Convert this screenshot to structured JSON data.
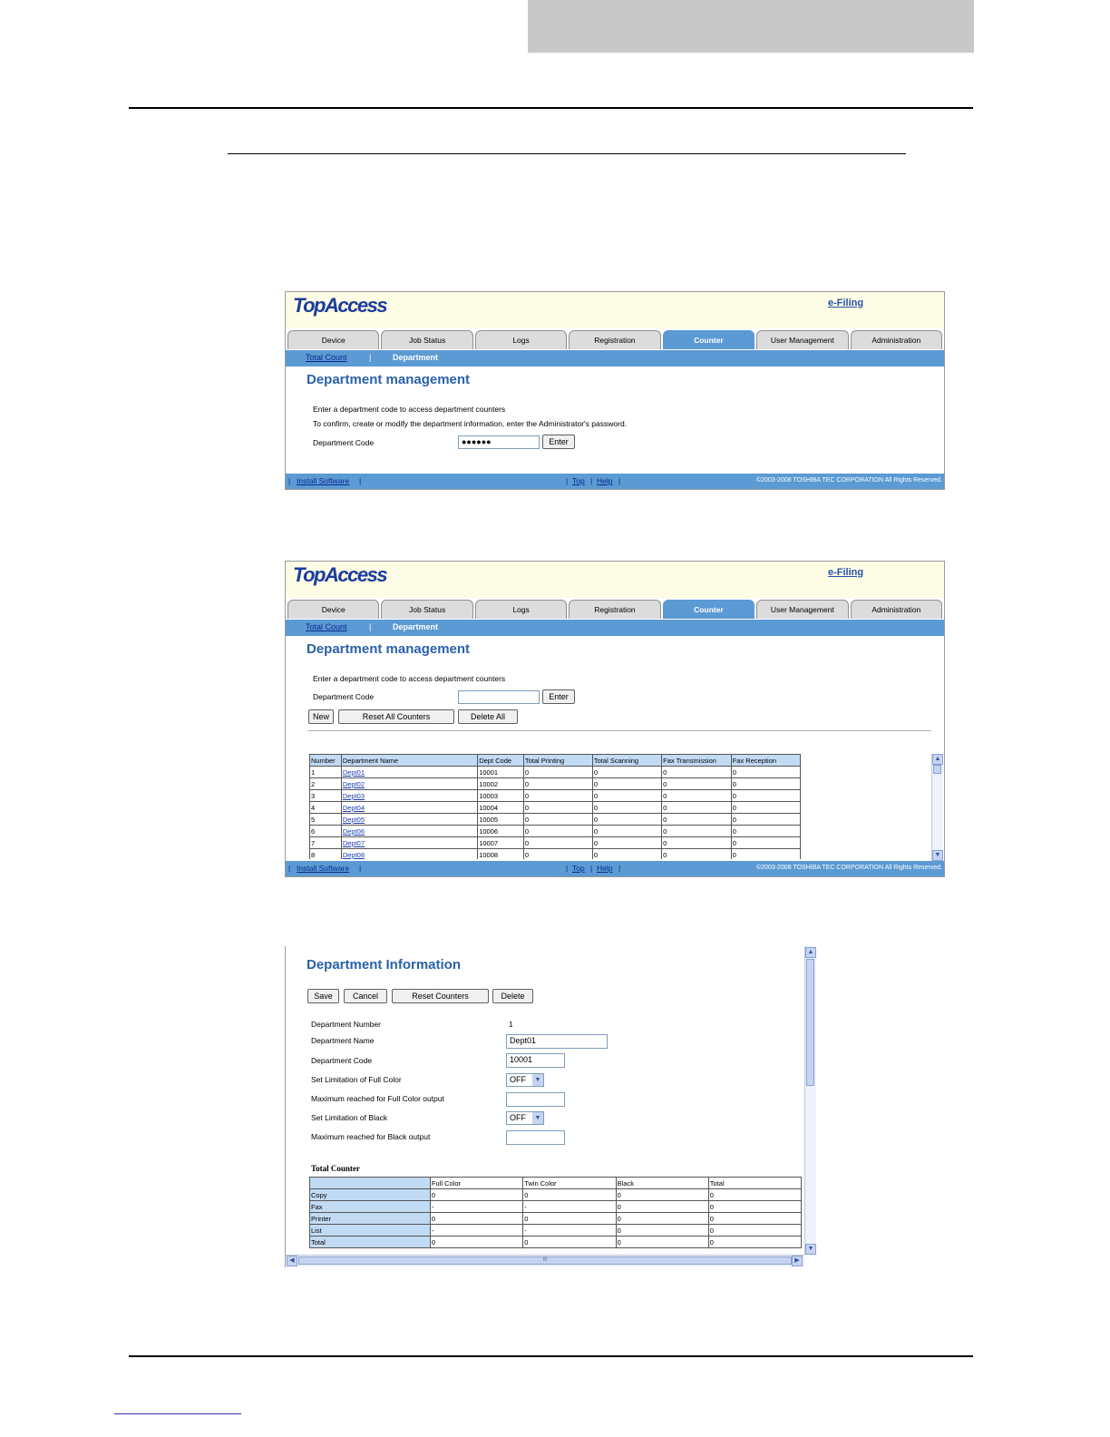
{
  "screen1": {
    "logo": "TopAccess",
    "efiling": "e-Filing",
    "tabs": [
      "Device",
      "Job Status",
      "Logs",
      "Registration",
      "Counter",
      "User Management",
      "Administration"
    ],
    "active_tab": "Counter",
    "subnav": {
      "link": "Total Count",
      "separator": "|",
      "current": "Department"
    },
    "title": "Department management",
    "line1": "Enter a department code to access department counters",
    "line2": "To confirm, create or modify the department information, enter the Administrator's password.",
    "code_label": "Department Code",
    "code_value": "●●●●●●",
    "enter_label": "Enter",
    "footer": {
      "install": "Install Software",
      "top": "Top",
      "help": "Help",
      "bar": "|",
      "copyright": "©2003-2008 TOSHIBA TEC CORPORATION All Rights Reserved."
    }
  },
  "screen2": {
    "logo": "TopAccess",
    "efiling": "e-Filing",
    "tabs": [
      "Device",
      "Job Status",
      "Logs",
      "Registration",
      "Counter",
      "User Management",
      "Administration"
    ],
    "subnav": {
      "link": "Total Count",
      "separator": "|",
      "current": "Department"
    },
    "title": "Department management",
    "line1": "Enter a department code to access department counters",
    "code_label": "Department Code",
    "enter_label": "Enter",
    "new_label": "New",
    "reset_all_label": "Reset All Counters",
    "delete_all_label": "Delete All",
    "table": {
      "headers": [
        "Number",
        "Department Name",
        "Dept Code",
        "Total Printing",
        "Total Scanning",
        "Fax Transmission",
        "Fax Reception"
      ],
      "rows": [
        [
          "1",
          "Dept01",
          "10001",
          "0",
          "0",
          "0",
          "0"
        ],
        [
          "2",
          "Dept02",
          "10002",
          "0",
          "0",
          "0",
          "0"
        ],
        [
          "3",
          "Dept03",
          "10003",
          "0",
          "0",
          "0",
          "0"
        ],
        [
          "4",
          "Dept04",
          "10004",
          "0",
          "0",
          "0",
          "0"
        ],
        [
          "5",
          "Dept05",
          "10005",
          "0",
          "0",
          "0",
          "0"
        ],
        [
          "6",
          "Dept06",
          "10006",
          "0",
          "0",
          "0",
          "0"
        ],
        [
          "7",
          "Dept07",
          "10007",
          "0",
          "0",
          "0",
          "0"
        ],
        [
          "8",
          "Dept08",
          "10008",
          "0",
          "0",
          "0",
          "0"
        ]
      ]
    },
    "footer": {
      "install": "Install Software",
      "top": "Top",
      "help": "Help",
      "bar": "|",
      "copyright": "©2003-2008 TOSHIBA TEC CORPORATION All Rights Reserved."
    }
  },
  "screen3": {
    "title": "Department Information",
    "save_label": "Save",
    "cancel_label": "Cancel",
    "reset_label": "Reset Counters",
    "delete_label": "Delete",
    "fields": {
      "number_label": "Department Number",
      "number_value": "1",
      "name_label": "Department Name",
      "name_value": "Dept01",
      "code_label": "Department Code",
      "code_value": "10001",
      "limit_color_label": "Set Limitation of Full Color",
      "limit_color_value": "OFF",
      "max_color_label": "Maximum reached for Full Color output",
      "limit_black_label": "Set Limitation of Black",
      "limit_black_value": "OFF",
      "max_black_label": "Maximum reached for Black output"
    },
    "total_counter_label": "Total Counter",
    "counter_table": {
      "headers": [
        "",
        "Full Color",
        "Twin Color",
        "Black",
        "Total"
      ],
      "rows": [
        [
          "Copy",
          "0",
          "0",
          "0",
          "0"
        ],
        [
          "Fax",
          "-",
          "-",
          "0",
          "0"
        ],
        [
          "Printer",
          "0",
          "0",
          "0",
          "0"
        ],
        [
          "List",
          "-",
          "-",
          "0",
          "0"
        ],
        [
          "Total",
          "0",
          "0",
          "0",
          "0"
        ]
      ]
    },
    "scroll_glyph": "III"
  }
}
